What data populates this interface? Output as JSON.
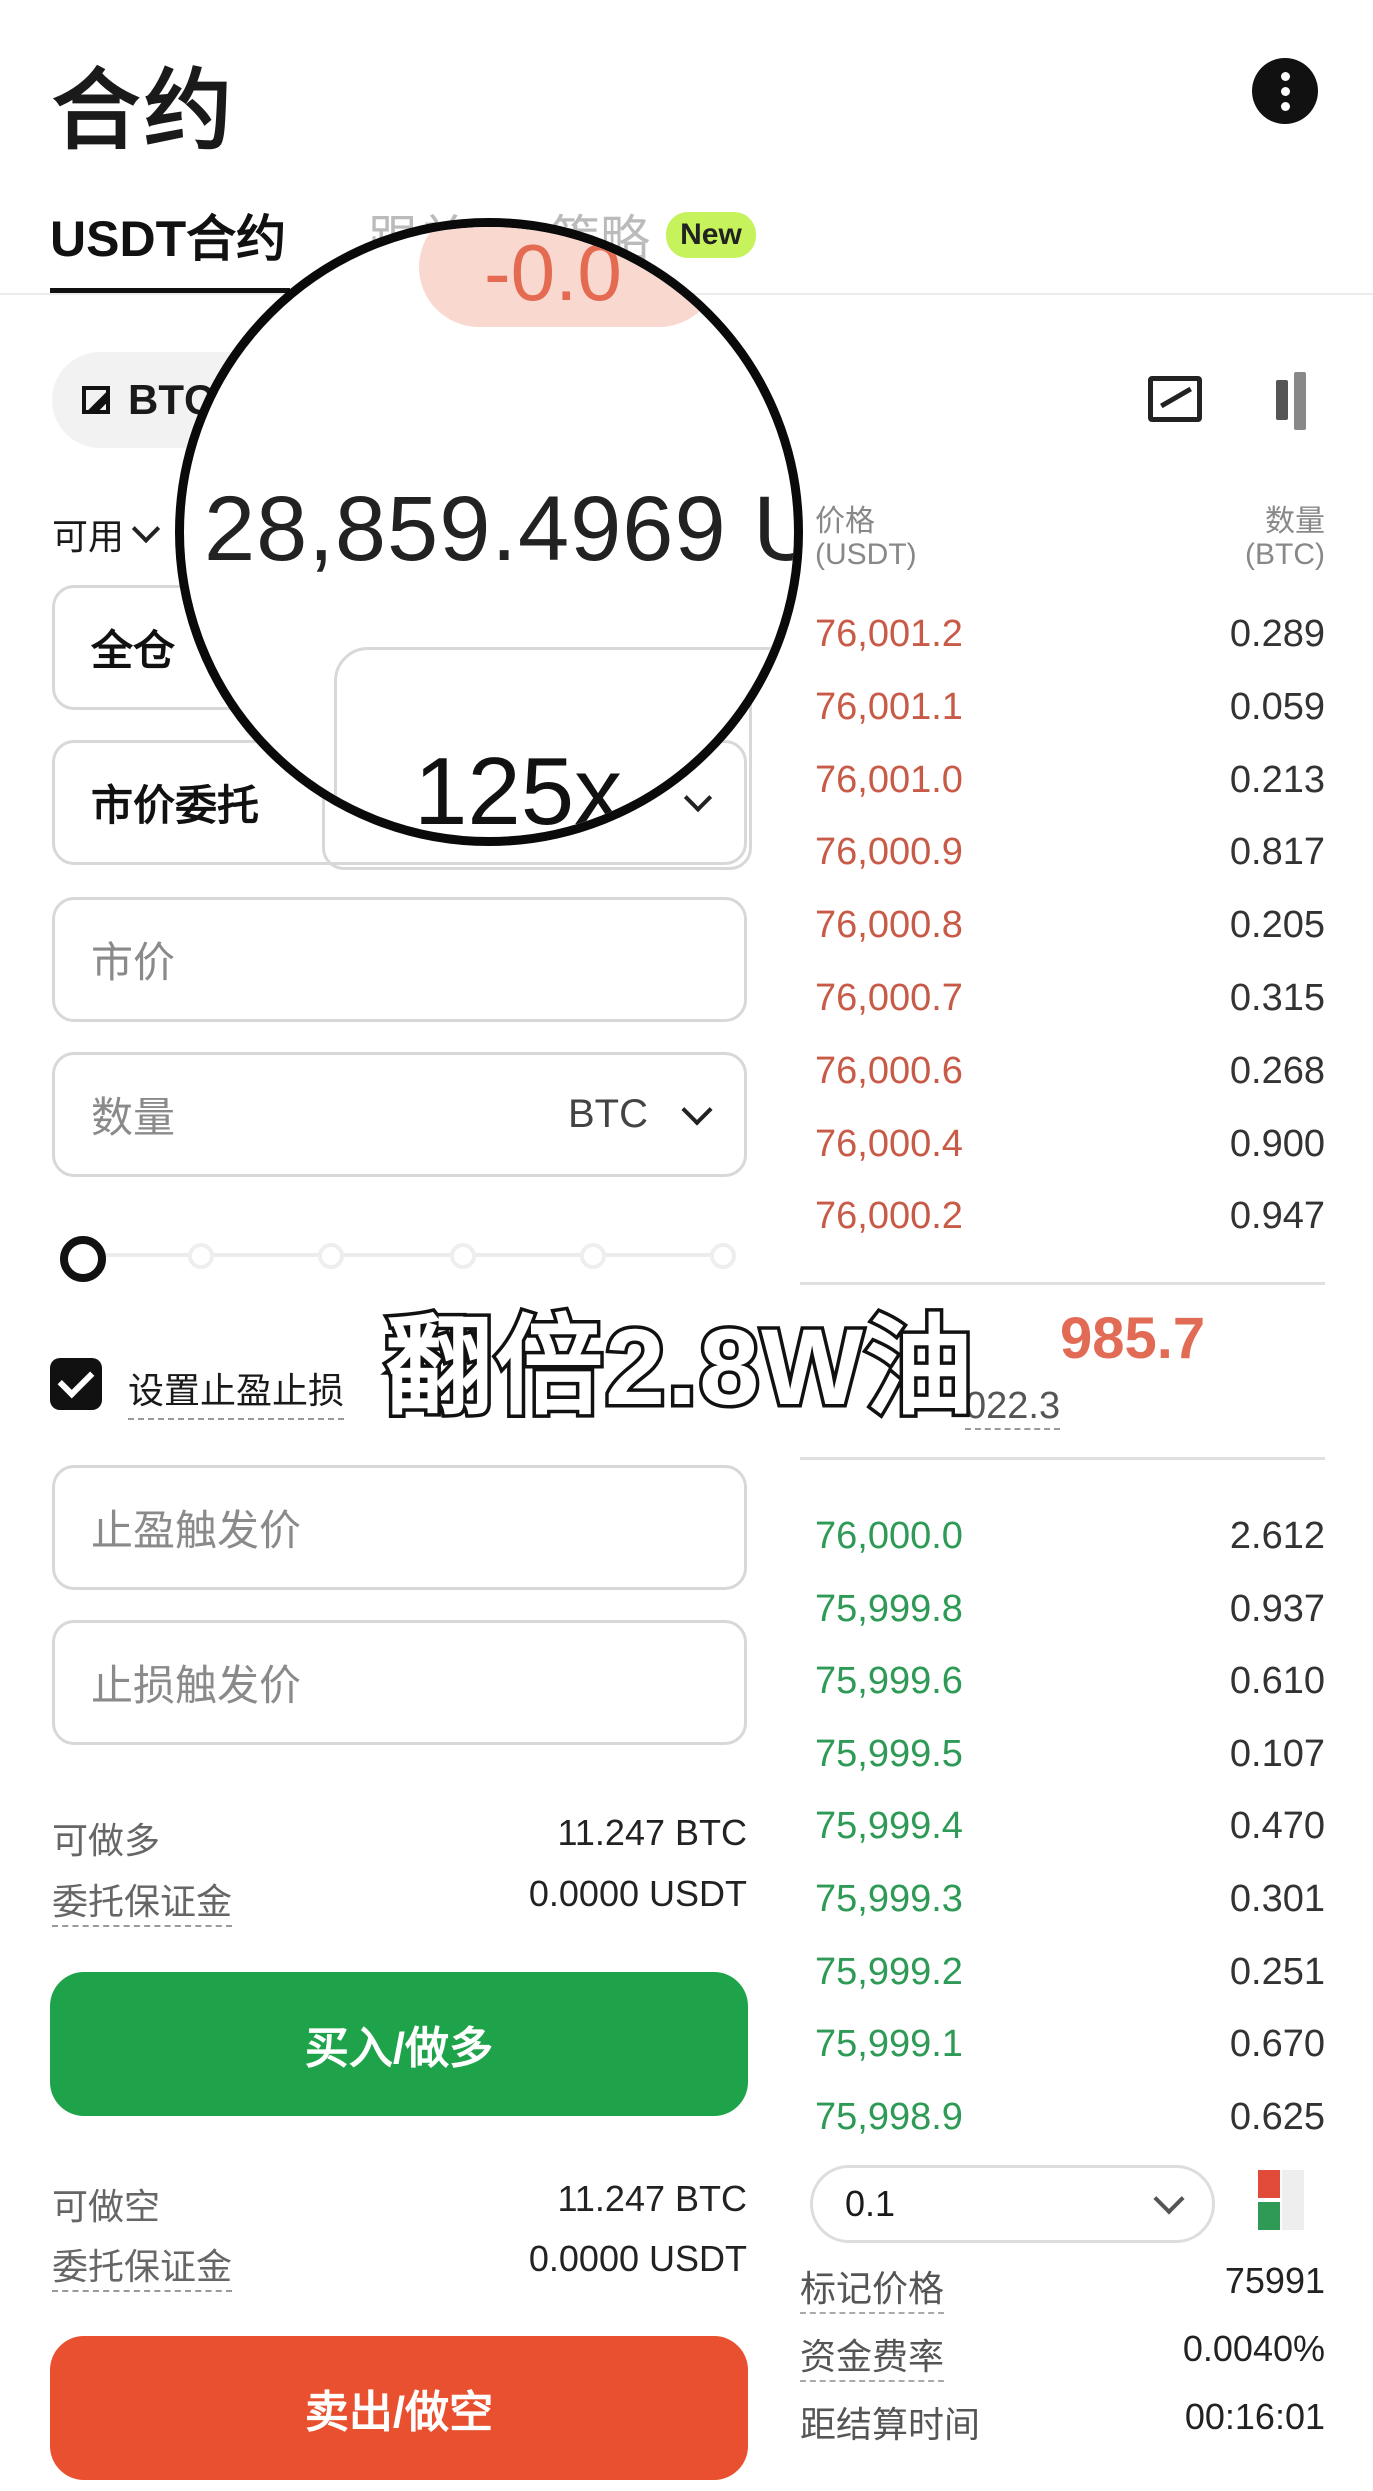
{
  "header": {
    "title": "合约"
  },
  "tabs": [
    {
      "label": "USDT合约"
    },
    {
      "label": "跟单"
    },
    {
      "label": "策略"
    }
  ],
  "new_badge": "New",
  "pair": {
    "label": "BTC"
  },
  "available": {
    "label": "可用"
  },
  "form": {
    "margin_mode": "全仓",
    "leverage": "125x",
    "order_type": "市价委托",
    "price_placeholder": "市价",
    "qty_placeholder": "数量",
    "qty_unit": "BTC",
    "tpsl_label": "设置止盈止损",
    "tp_placeholder": "止盈触发价",
    "sl_placeholder": "止损触发价"
  },
  "long_info": {
    "can_long_label": "可做多",
    "can_long_value": "11.247 BTC",
    "margin_label": "委托保证金",
    "margin_value": "0.0000 USDT"
  },
  "short_info": {
    "can_short_label": "可做空",
    "can_short_value": "11.247 BTC",
    "margin_label": "委托保证金",
    "margin_value": "0.0000 USDT"
  },
  "buttons": {
    "buy": "买入/做多",
    "sell": "卖出/做空"
  },
  "orderbook": {
    "price_header": "价格",
    "price_unit": "(USDT)",
    "qty_header": "数量",
    "qty_unit": "(BTC)",
    "asks": [
      {
        "price": "76,001.2",
        "qty": "0.289"
      },
      {
        "price": "76,001.1",
        "qty": "0.059"
      },
      {
        "price": "76,001.0",
        "qty": "0.213"
      },
      {
        "price": "76,000.9",
        "qty": "0.817"
      },
      {
        "price": "76,000.8",
        "qty": "0.205"
      },
      {
        "price": "76,000.7",
        "qty": "0.315"
      },
      {
        "price": "76,000.6",
        "qty": "0.268"
      },
      {
        "price": "76,000.4",
        "qty": "0.900"
      },
      {
        "price": "76,000.2",
        "qty": "0.947"
      }
    ],
    "last_price": "985.7",
    "mark_sub": "022.3",
    "bids": [
      {
        "price": "76,000.0",
        "qty": "2.612"
      },
      {
        "price": "75,999.8",
        "qty": "0.937"
      },
      {
        "price": "75,999.6",
        "qty": "0.610"
      },
      {
        "price": "75,999.5",
        "qty": "0.107"
      },
      {
        "price": "75,999.4",
        "qty": "0.470"
      },
      {
        "price": "75,999.3",
        "qty": "0.301"
      },
      {
        "price": "75,999.2",
        "qty": "0.251"
      },
      {
        "price": "75,999.1",
        "qty": "0.670"
      },
      {
        "price": "75,998.9",
        "qty": "0.625"
      }
    ],
    "depth": "0.1"
  },
  "stats": {
    "mark_price_label": "标记价格",
    "mark_price_value": "75991",
    "funding_label": "资金费率",
    "funding_value": "0.0040%",
    "settle_label": "距结算时间",
    "settle_value": "00:16:01"
  },
  "overlay": {
    "magnifier_balance": "28,859.4969 U",
    "magnifier_leverage": "125x",
    "magnifier_chip": "-0.0",
    "caption": "翻倍2.8W油"
  },
  "colors": {
    "buy": "#1ea34a",
    "sell": "#e8502f",
    "ask": "#c85b47",
    "bid": "#2e9a55",
    "badge": "#c6f35c"
  }
}
